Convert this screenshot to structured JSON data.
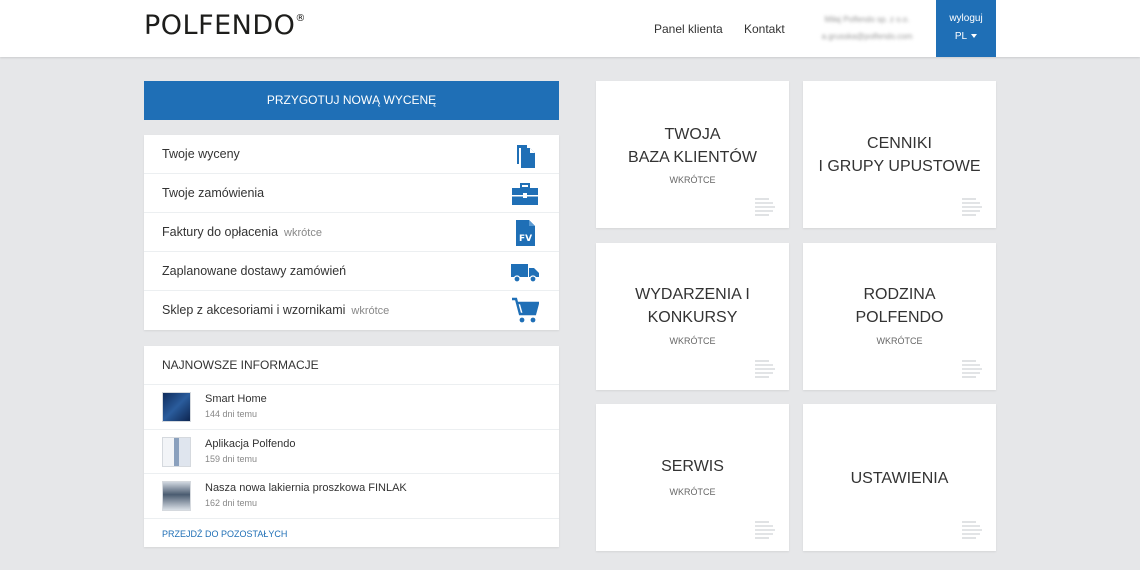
{
  "header": {
    "logo_text": "POLFENDO",
    "logo_mark": "®",
    "nav": {
      "panel": "Panel klienta",
      "contact": "Kontakt"
    },
    "user": {
      "company": "Miłaj Polfendo sp. z o.o.",
      "email": "a.grusska@polfendo.com"
    },
    "logout": "wyloguj",
    "language": "PL"
  },
  "primary_button": "PRZYGOTUJ NOWĄ WYCENĘ",
  "menu": {
    "items": [
      {
        "label": "Twoje wyceny",
        "soon": "",
        "icon": "documents-icon"
      },
      {
        "label": "Twoje zamówienia",
        "soon": "",
        "icon": "briefcase-icon"
      },
      {
        "label": "Faktury do opłacenia",
        "soon": "wkrótce",
        "icon": "invoice-icon"
      },
      {
        "label": "Zaplanowane dostawy zamówień",
        "soon": "",
        "icon": "truck-icon"
      },
      {
        "label": "Sklep z akcesoriami i wzornikami",
        "soon": "wkrótce",
        "icon": "cart-icon"
      }
    ]
  },
  "news": {
    "title": "NAJNOWSZE INFORMACJE",
    "items": [
      {
        "name": "Smart Home",
        "date": "144 dni temu"
      },
      {
        "name": "Aplikacja Polfendo",
        "date": "159 dni temu"
      },
      {
        "name": "Nasza nowa lakiernia proszkowa FINLAK",
        "date": "162 dni temu"
      }
    ],
    "more": "PRZEJDŹ DO POZOSTAŁYCH"
  },
  "tiles": [
    {
      "title": "TWOJA\nBAZA KLIENTÓW",
      "soon": "WKRÓTCE"
    },
    {
      "title": "CENNIKI\nI GRUPY UPUSTOWE",
      "soon": ""
    },
    {
      "title": "WYDARZENIA I\nKONKURSY",
      "soon": "WKRÓTCE"
    },
    {
      "title": "RODZINA\nPOLFENDO",
      "soon": "WKRÓTCE"
    },
    {
      "title": "SERWIS",
      "soon": "WKRÓTCE"
    },
    {
      "title": "USTAWIENIA",
      "soon": ""
    }
  ],
  "colors": {
    "accent": "#1f6fb6",
    "background": "#e6e7e9",
    "tile_icon": "#d9dbde"
  }
}
